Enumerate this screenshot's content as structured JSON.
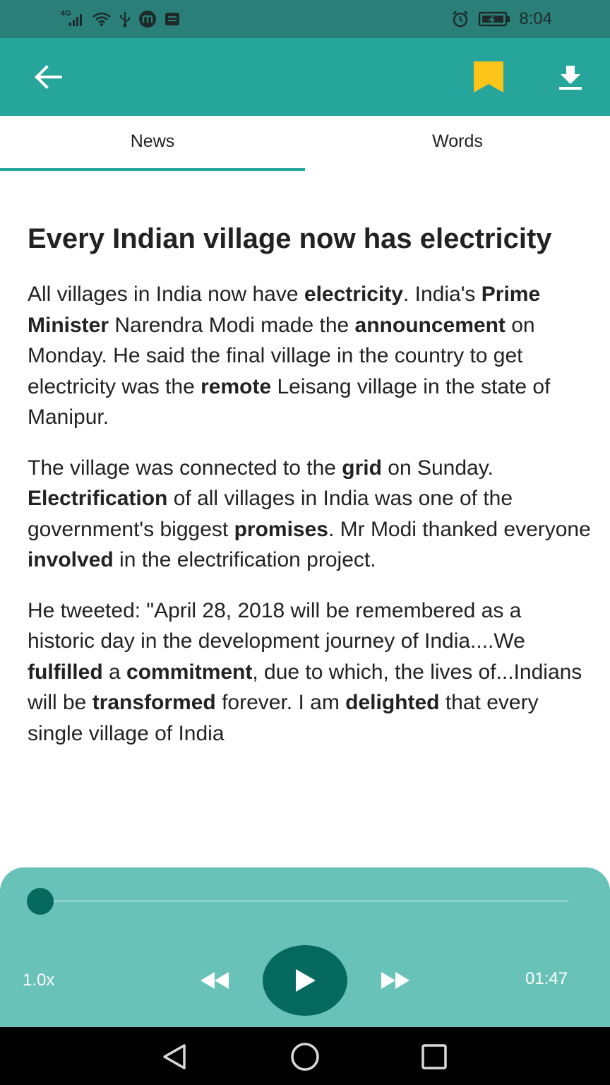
{
  "status_bar": {
    "network_label": "4G",
    "time": "8:04",
    "icons": [
      "signal-icon",
      "wifi-icon",
      "usb-icon",
      "m-app-icon",
      "notification-icon",
      "alarm-icon",
      "battery-charging-icon"
    ]
  },
  "app_bar": {
    "back_icon": "arrow-left-icon",
    "bookmark_icon": "bookmark-icon",
    "bookmark_color": "#fcc419",
    "download_icon": "download-icon",
    "background_color": "#26a69a"
  },
  "tabs": [
    {
      "label": "News",
      "selected": true
    },
    {
      "label": "Words",
      "selected": false
    }
  ],
  "article": {
    "title": "Every Indian village now has electricity",
    "paragraphs": [
      [
        {
          "t": "All villages in India now have "
        },
        {
          "t": "electricity",
          "b": true
        },
        {
          "t": ". India's "
        },
        {
          "t": "Prime Minister",
          "b": true
        },
        {
          "t": " Narendra Modi made the "
        },
        {
          "t": "announcement",
          "b": true
        },
        {
          "t": " on Monday. He said the final village in the country to get electricity was the "
        },
        {
          "t": "remote",
          "b": true
        },
        {
          "t": " Leisang village in the state of Manipur."
        }
      ],
      [
        {
          "t": "The village was connected to the "
        },
        {
          "t": "grid",
          "b": true
        },
        {
          "t": " on Sunday. "
        },
        {
          "t": "Electrification",
          "b": true
        },
        {
          "t": " of all villages in India was one of the government's biggest "
        },
        {
          "t": "promises",
          "b": true
        },
        {
          "t": ". Mr Modi thanked everyone "
        },
        {
          "t": "involved",
          "b": true
        },
        {
          "t": " in the electrification project."
        }
      ],
      [
        {
          "t": "He tweeted: \"April 28, 2018 will be remembered as a historic day in the development journey of India....We "
        },
        {
          "t": "fulfilled",
          "b": true
        },
        {
          "t": " a "
        },
        {
          "t": "commitment",
          "b": true
        },
        {
          "t": ", due to which, the lives of...Indians will be "
        },
        {
          "t": "transformed",
          "b": true
        },
        {
          "t": " forever. I am "
        },
        {
          "t": "delighted",
          "b": true
        },
        {
          "t": " that every single village of India"
        }
      ]
    ]
  },
  "player": {
    "speed": "1.0x",
    "time": "01:47",
    "progress": 0.0,
    "rewind_icon": "rewind-icon",
    "play_icon": "play-icon",
    "forward_icon": "fast-forward-icon",
    "background_color": "#68c2b8",
    "accent_color": "#06695f"
  },
  "nav_bar": {
    "icons": [
      "back-triangle-icon",
      "home-circle-icon",
      "recents-square-icon"
    ]
  }
}
